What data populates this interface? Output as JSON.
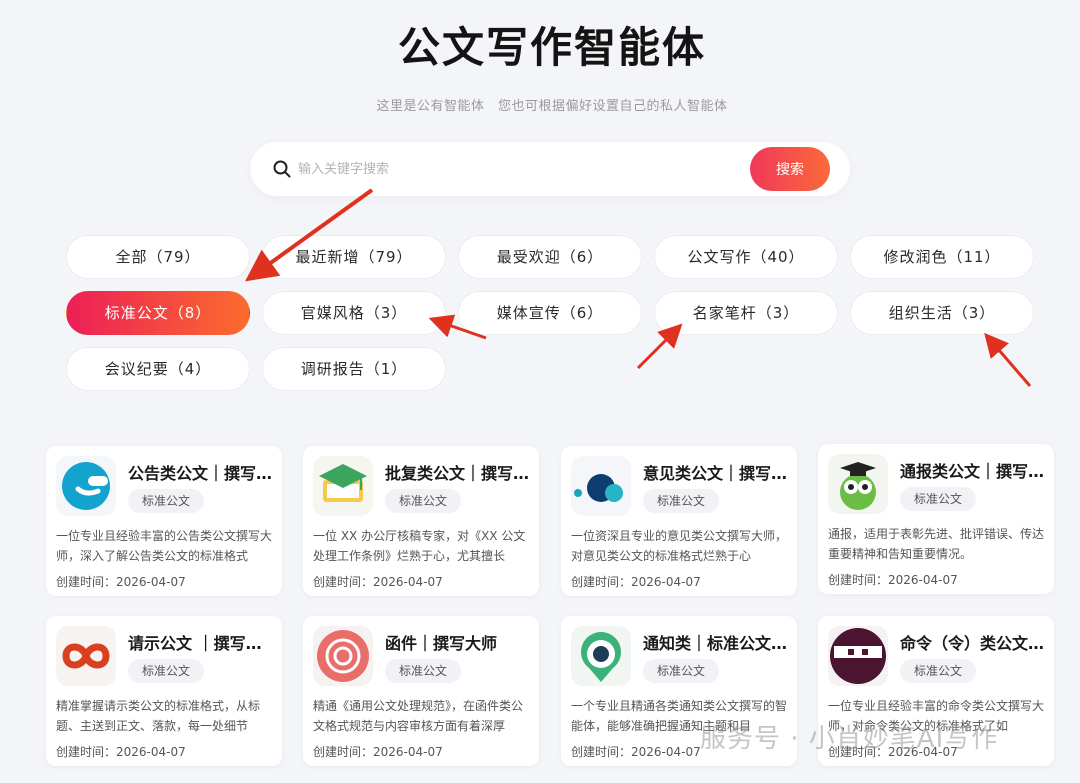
{
  "header": {
    "title": "公文写作智能体",
    "subtitle": "这里是公有智能体　您也可根据偏好设置自己的私人智能体"
  },
  "search": {
    "placeholder": "输入关键字搜索",
    "button_label": "搜索"
  },
  "tags": [
    {
      "label": "全部（79）",
      "active": false
    },
    {
      "label": "最近新增（79）",
      "active": false
    },
    {
      "label": "最受欢迎（6）",
      "active": false
    },
    {
      "label": "公文写作（40）",
      "active": false
    },
    {
      "label": "修改润色（11）",
      "active": false
    },
    {
      "label": "标准公文（8）",
      "active": true
    },
    {
      "label": "官媒风格（3）",
      "active": false
    },
    {
      "label": "媒体宣传（6）",
      "active": false
    },
    {
      "label": "名家笔杆（3）",
      "active": false
    },
    {
      "label": "组织生活（3）",
      "active": false
    },
    {
      "label": "会议纪要（4）",
      "active": false
    },
    {
      "label": "调研报告（1）",
      "active": false
    }
  ],
  "cards": [
    {
      "title": "公告类公文｜撰写大师",
      "badge": "标准公文",
      "desc": "一位专业且经验丰富的公告类公文撰写大师，深入了解公告类公文的标准格式",
      "time": "创建时间：2026-04-07",
      "icon": "blue-e-icon"
    },
    {
      "title": "批复类公文｜撰写大师",
      "badge": "标准公文",
      "desc": "一位 XX 办公厅核稿专家，对《XX 公文处理工作条例》烂熟于心，尤其擅长",
      "time": "创建时间：2026-04-07",
      "icon": "graduation-cap-icon"
    },
    {
      "title": "意见类公文｜撰写大师",
      "badge": "标准公文",
      "desc": "一位资深且专业的意见类公文撰写大师，对意见类公文的标准格式烂熟于心",
      "time": "创建时间：2026-04-07",
      "icon": "dots-icon"
    },
    {
      "title": "通报类公文｜撰写大师",
      "badge": "标准公文",
      "desc": "通报，适用于表彰先进、批评错误、传达重要精神和告知重要情况。",
      "time": "创建时间：2026-04-07",
      "icon": "owl-icon"
    },
    {
      "title": "请示公文 ｜撰写大师",
      "badge": "标准公文",
      "desc": "精准掌握请示类公文的标准格式，从标题、主送到正文、落款，每一处细节",
      "time": "创建时间：2026-04-07",
      "icon": "infinity-icon"
    },
    {
      "title": "函件｜撰写大师",
      "badge": "标准公文",
      "desc": "精通《通用公文处理规范》，在函件类公文格式规范与内容审核方面有着深厚",
      "time": "创建时间：2026-04-07",
      "icon": "target-icon"
    },
    {
      "title": "通知类｜标准公文撰写",
      "badge": "标准公文",
      "desc": "一个专业且精通各类通知类公文撰写的智能体，能够准确把握通知主题和目",
      "time": "创建时间：2026-04-07",
      "icon": "location-pin-icon"
    },
    {
      "title": "命令（令）类公文撰写",
      "badge": "标准公文",
      "desc": "一位专业且经验丰富的命令类公文撰写大师，对命令类公文的标准格式了如",
      "time": "创建时间：2026-04-07",
      "icon": "ninja-icon"
    }
  ],
  "watermark": "服务号 · 小肖妙笔AI写作",
  "colors": {
    "accent_start": "#ec1f56",
    "accent_end": "#fb6c2e",
    "arrow": "#e0301e"
  }
}
